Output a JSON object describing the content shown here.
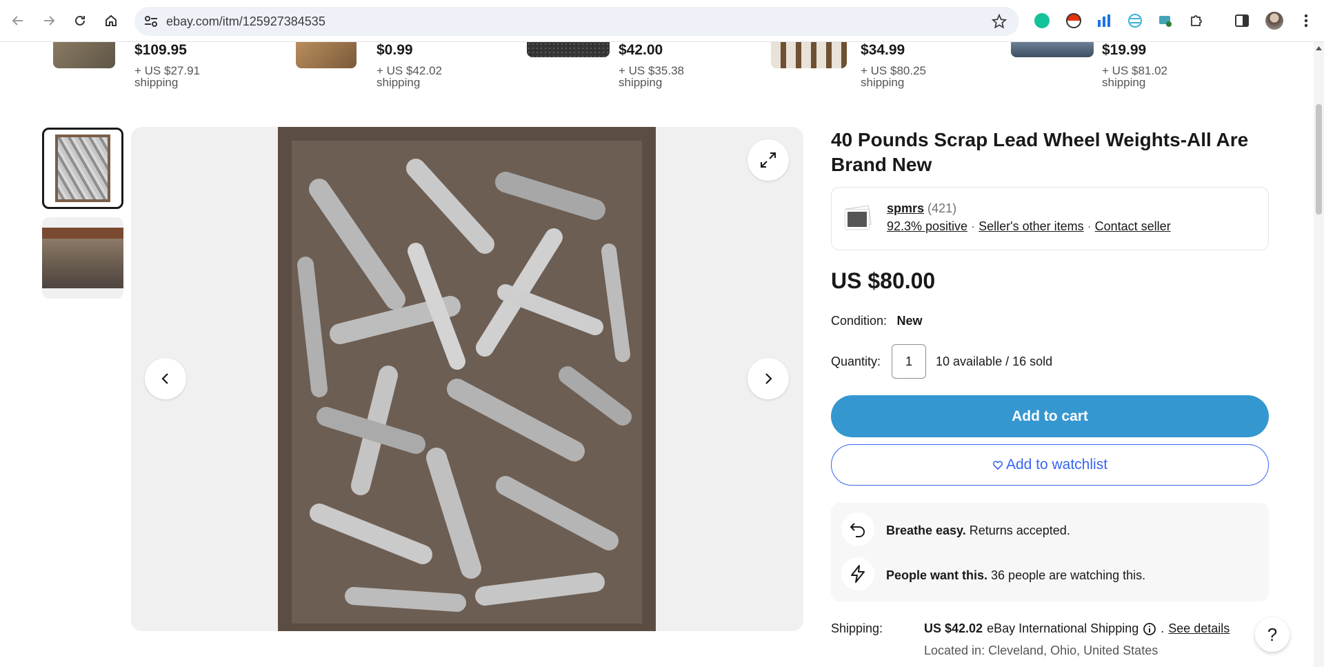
{
  "browser": {
    "url": "ebay.com/itm/125927384535"
  },
  "recommendations": [
    {
      "price": "$109.95",
      "shipping": "+ US $27.91 shipping"
    },
    {
      "price": "$0.99",
      "shipping": "+ US $42.02 shipping"
    },
    {
      "price": "$42.00",
      "shipping": "+ US $35.38 shipping"
    },
    {
      "price": "$34.99",
      "shipping": "+ US $80.25 shipping"
    },
    {
      "price": "$19.99",
      "shipping": "+ US $81.02 shipping"
    }
  ],
  "listing": {
    "title": "40 Pounds Scrap Lead Wheel Weights-All Are Brand New",
    "seller": {
      "name": "spmrs",
      "rating_count": "(421)",
      "positive": "92.3% positive",
      "other_items": "Seller's other items",
      "contact": "Contact seller",
      "separator": "·"
    },
    "price": "US $80.00",
    "condition_label": "Condition:",
    "condition_value": "New",
    "quantity_label": "Quantity:",
    "quantity_value": "1",
    "availability": "10 available / 16 sold",
    "add_to_cart": "Add to cart",
    "add_to_watchlist": "Add to watchlist",
    "info": {
      "returns_bold": "Breathe easy.",
      "returns_text": " Returns accepted.",
      "watchers_bold": "People want this.",
      "watchers_text": " 36 people are watching this."
    },
    "shipping_label": "Shipping:",
    "shipping_price": "US $42.02",
    "shipping_method": "eBay International Shipping",
    "see_details": "See details",
    "shipping_dot": ".",
    "location": "Located in: Cleveland, Ohio, United States"
  },
  "help_label": "?",
  "colors": {
    "cart_button": "#3597d0",
    "watchlist_border": "#3665f3",
    "info_box_bg": "#f7f7f7"
  }
}
